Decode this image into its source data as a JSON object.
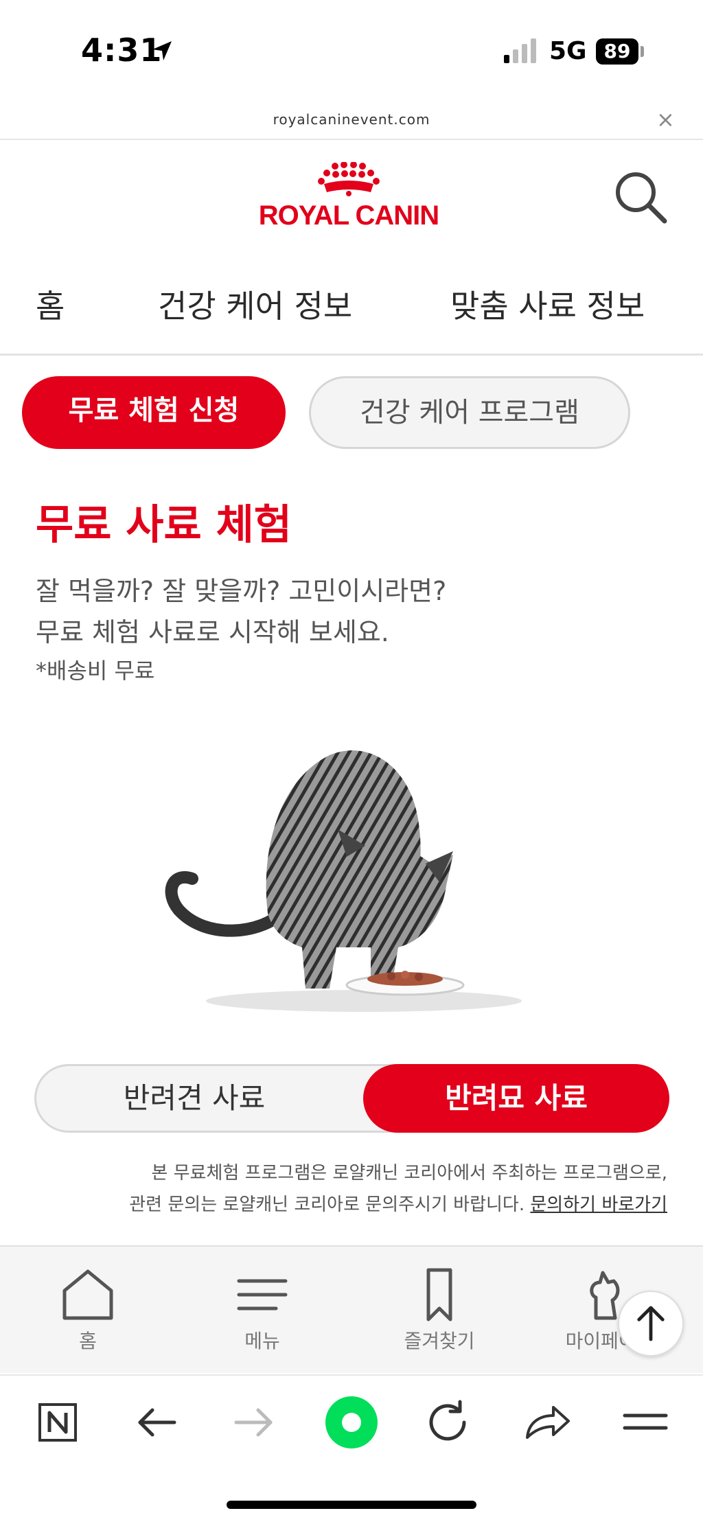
{
  "status_bar": {
    "time": "4:31",
    "network": "5G",
    "battery": "89"
  },
  "url_bar": {
    "url": "royalcaninevent.com",
    "close": "×"
  },
  "header": {
    "logo_text": "ROYAL CANIN"
  },
  "nav": {
    "items": [
      "홈",
      "건강 케어 정보",
      "맞춤 사료 정보"
    ]
  },
  "tabs": {
    "active": "무료 체험 신청",
    "inactive": "건강 케어 프로그램"
  },
  "main": {
    "title": "무료 사료 체험",
    "desc_line1": "잘 먹을까? 잘 맞을까? 고민이시라면?",
    "desc_line2": "무료 체험 사료로 시작해 보세요.",
    "note": "*배송비 무료"
  },
  "toggle": {
    "dog": "반려견 사료",
    "cat": "반려묘 사료"
  },
  "disclaimer": {
    "line1": "본 무료체험 프로그램은 로얄캐닌 코리아에서 주최하는 프로그램으로,",
    "line2": "관련 문의는 로얄캐닌 코리아로 문의주시기 바랍니다.",
    "link": "문의하기 바로가기"
  },
  "footer": {
    "items": [
      {
        "label": "홈",
        "icon": "home-icon"
      },
      {
        "label": "메뉴",
        "icon": "menu-icon"
      },
      {
        "label": "즐겨찾기",
        "icon": "bookmark-icon"
      },
      {
        "label": "마이페이지",
        "icon": "pet-icon"
      }
    ]
  },
  "colors": {
    "brand_red": "#e2001a",
    "toolbar_green": "#00de5a"
  }
}
